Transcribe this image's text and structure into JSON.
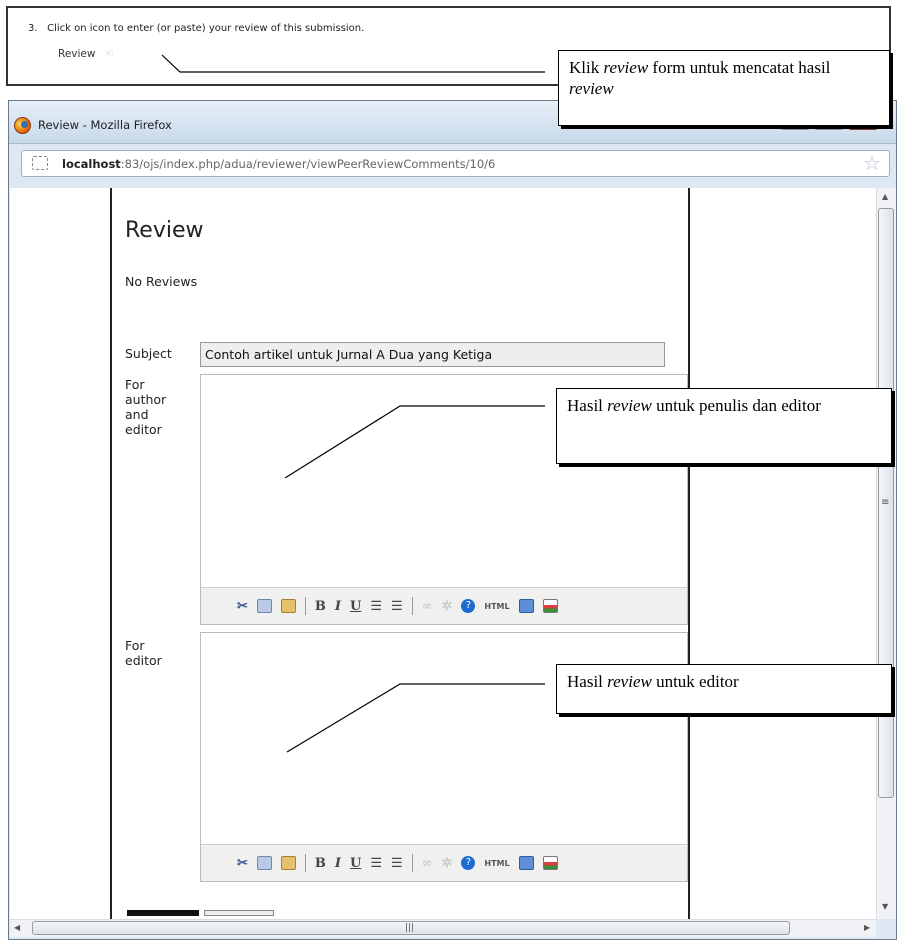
{
  "instruction": {
    "step": "3.",
    "text": "Click on icon to enter (or paste) your review of this submission.",
    "review_label": "Review"
  },
  "window": {
    "title": "Review - Mozilla Firefox",
    "url_host": "localhost",
    "url_rest": ":83/ojs/index.php/adua/reviewer/viewPeerReviewComments/10/6"
  },
  "page": {
    "heading": "Review",
    "no_reviews": "No Reviews",
    "subject_label": "Subject",
    "subject_value": "Contoh artikel untuk Jurnal A Dua yang Ketiga",
    "author_editor_label": [
      "For",
      "author",
      "and",
      "editor"
    ],
    "editor_label": [
      "For",
      "editor"
    ]
  },
  "toolbar": {
    "icons": [
      "cut-icon",
      "copy-icon",
      "paste-icon",
      "bold-icon",
      "italic-icon",
      "underline-icon",
      "bullet-list-icon",
      "numbered-list-icon",
      "link-icon",
      "unlink-icon",
      "help-icon",
      "html-icon",
      "fullscreen-icon",
      "image-icon"
    ],
    "bold": "B",
    "italic": "I",
    "underline": "U",
    "html": "HTML"
  },
  "callouts": {
    "review_form": {
      "pre": "Klik ",
      "em": "review",
      "post": " form untuk mencatat hasil ",
      "em2": "review"
    },
    "author_editor": {
      "pre": "Hasil ",
      "em": "review",
      "post": " untuk penulis dan editor"
    },
    "editor_only": {
      "pre": "Hasil ",
      "em": "review",
      "post": " untuk editor"
    }
  }
}
